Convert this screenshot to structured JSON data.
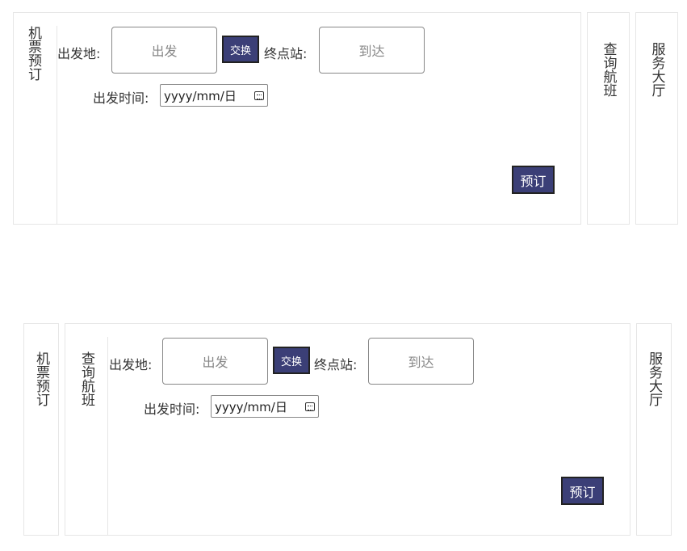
{
  "tabs": {
    "ticket": "机票预订",
    "query": "查询航班",
    "service": "服务大厅"
  },
  "form": {
    "from_label": "出发地:",
    "from_placeholder": "出发",
    "swap_label": "交换",
    "to_label": "终点站:",
    "to_placeholder": "到达",
    "date_label": "出发时间:",
    "date_value": "yyyy/mm/日",
    "book_label": "预订"
  },
  "colors": {
    "accent": "#3b3f77",
    "border": "#e6e6e6"
  },
  "icons": {
    "date_picker": "calendar-icon"
  }
}
